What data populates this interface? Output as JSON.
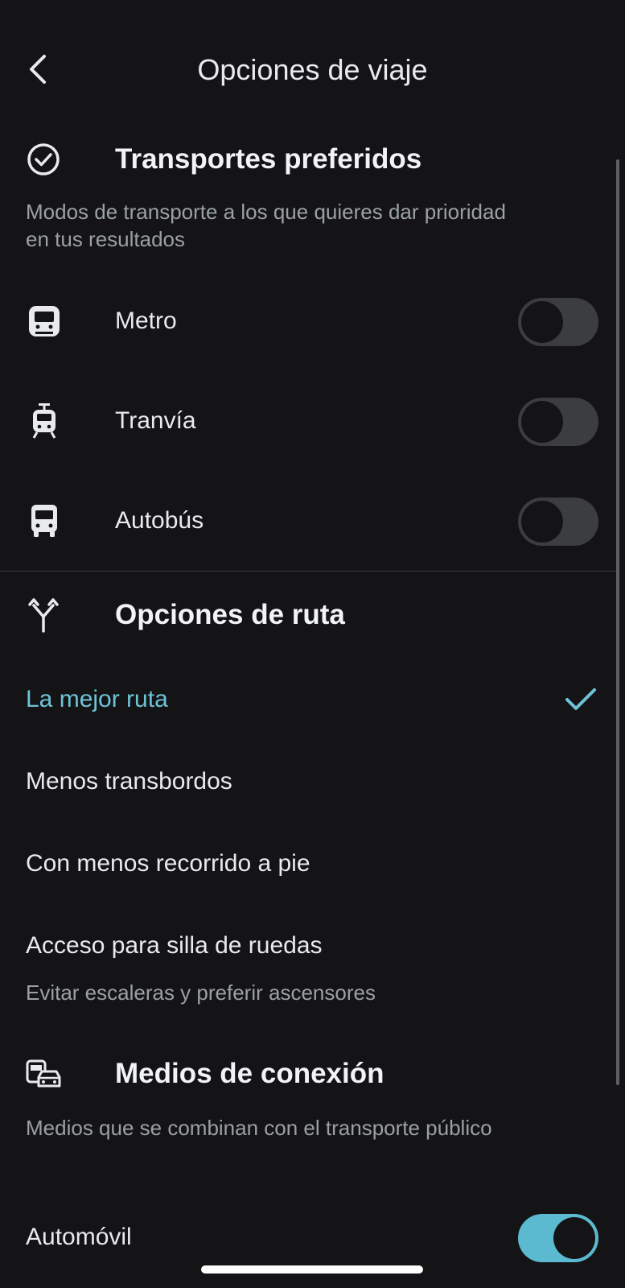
{
  "header": {
    "title": "Opciones de viaje",
    "back_icon": "chevron-left-icon"
  },
  "preferred_transport": {
    "icon": "check-circle-icon",
    "title": "Transportes preferidos",
    "description": "Modos de transporte a los que quieres dar prioridad en tus resultados",
    "items": [
      {
        "label": "Metro",
        "icon": "subway-icon",
        "enabled": false
      },
      {
        "label": "Tranvía",
        "icon": "tram-icon",
        "enabled": false
      },
      {
        "label": "Autobús",
        "icon": "bus-icon",
        "enabled": false
      }
    ]
  },
  "route_options": {
    "icon": "fork-arrows-icon",
    "title": "Opciones de ruta",
    "options": [
      {
        "label": "La mejor ruta",
        "selected": true
      },
      {
        "label": "Menos transbordos",
        "selected": false
      },
      {
        "label": "Con menos recorrido a pie",
        "selected": false
      },
      {
        "label": "Acceso para silla de ruedas",
        "sublabel": "Evitar escaleras y preferir ascensores",
        "selected": false
      }
    ]
  },
  "connection_modes": {
    "icon": "car-transit-icon",
    "title": "Medios de conexión",
    "description": "Medios que se combinan con el transporte público",
    "items": [
      {
        "label": "Automóvil",
        "enabled": true
      }
    ]
  },
  "colors": {
    "background": "#141416",
    "accent": "#5bbad0",
    "selected_text": "#6ec3d6"
  }
}
